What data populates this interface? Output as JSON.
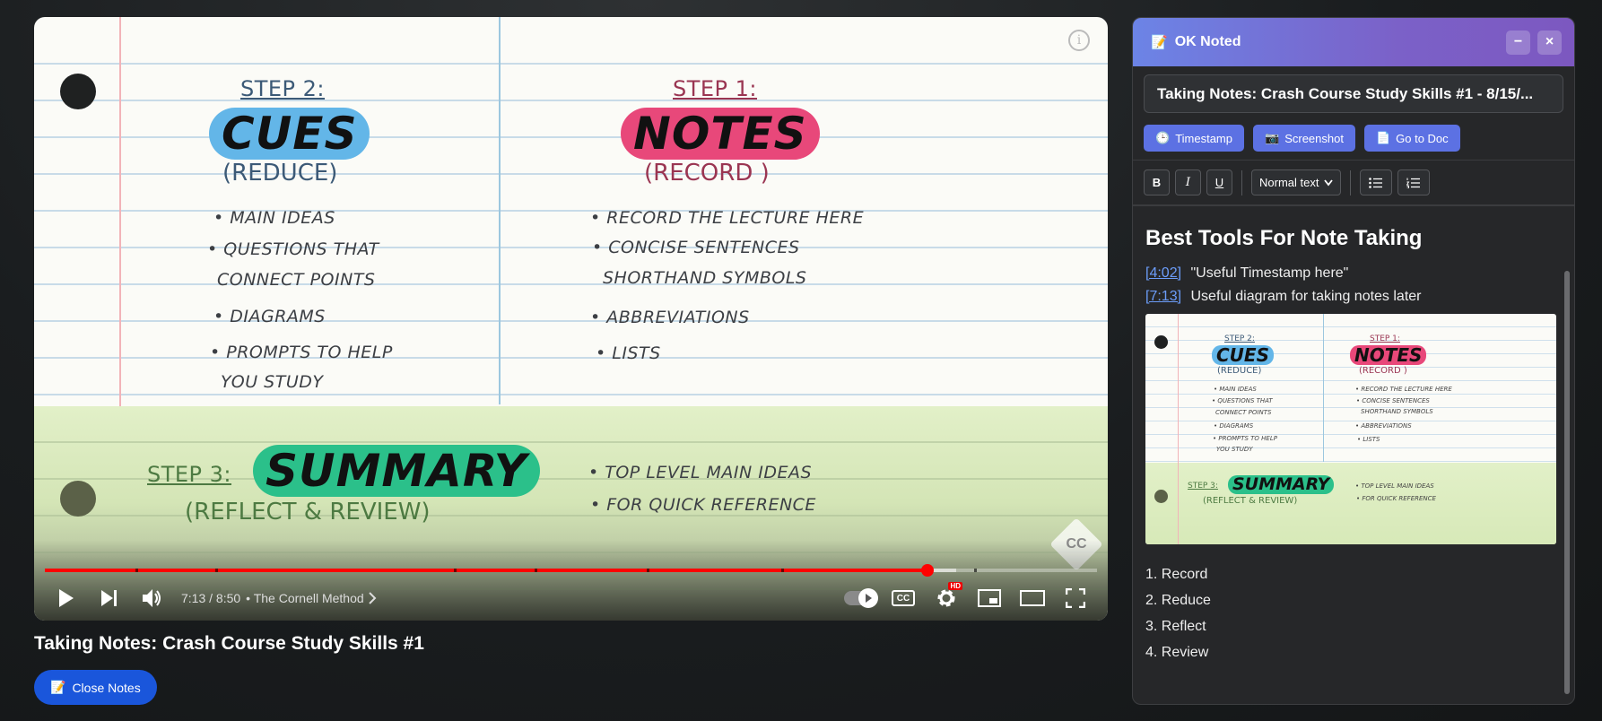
{
  "video": {
    "info_icon": "i",
    "watermark": "CC",
    "slide": {
      "step2_label": "STEP 2:",
      "cues_word": "CUES",
      "cues_sub": "(REDUCE)",
      "cues_items": [
        "• MAIN IDEAS",
        "• QUESTIONS THAT",
        "CONNECT POINTS",
        "• DIAGRAMS",
        "• PROMPTS TO HELP",
        "YOU STUDY"
      ],
      "step1_label": "STEP 1:",
      "notes_word": "NOTES",
      "notes_sub": "(RECORD )",
      "notes_items": [
        "• RECORD THE LECTURE HERE",
        "• CONCISE SENTENCES",
        "SHORTHAND SYMBOLS",
        "• ABBREVIATIONS",
        "• LISTS"
      ],
      "step3_label": "STEP 3:",
      "summary_word": "SUMMARY",
      "summary_sub": "(REFLECT & REVIEW)",
      "summary_items": [
        "• TOP LEVEL MAIN IDEAS",
        "• FOR QUICK REFERENCE"
      ]
    },
    "progress_fraction": 0.8392,
    "buffered_fraction": 0.866,
    "time": "7:13 / 8:50",
    "chapter": "• The Cornell Method",
    "hd_badge": "HD",
    "cc_label": "CC",
    "title": "Taking Notes: Crash Course Study Skills #1"
  },
  "close_notes": {
    "label": "Close Notes",
    "icon": "memo-icon"
  },
  "panel": {
    "title": "OK Noted",
    "doc_title": "Taking Notes: Crash Course Study Skills #1 - 8/15/...",
    "buttons": {
      "minimize": "−",
      "close": "×",
      "timestamp": "Timestamp",
      "screenshot": "Screenshot",
      "go_to_doc": "Go to Doc"
    },
    "toolbar": {
      "bold": "B",
      "italic": "I",
      "underline": "U",
      "text_style": "Normal text"
    },
    "content": {
      "heading": "Best Tools For Note Taking",
      "timestamps": [
        {
          "time": "[4:02]",
          "text": "\"Useful Timestamp here\""
        },
        {
          "time": "[7:13]",
          "text": "Useful diagram for taking notes later"
        }
      ],
      "steps": [
        "1. Record",
        "2. Reduce",
        "3. Reflect",
        "4. Review"
      ]
    }
  },
  "colors": {
    "accent_blue": "#1a56db",
    "panel_header_start": "#6c84e6",
    "panel_header_end": "#7c58c0",
    "progress_red": "#ff0000",
    "link_blue": "#6c9dfa",
    "cues_brush": "#63b6e8",
    "notes_brush": "#e8487a",
    "summary_brush": "#2bc08a"
  }
}
